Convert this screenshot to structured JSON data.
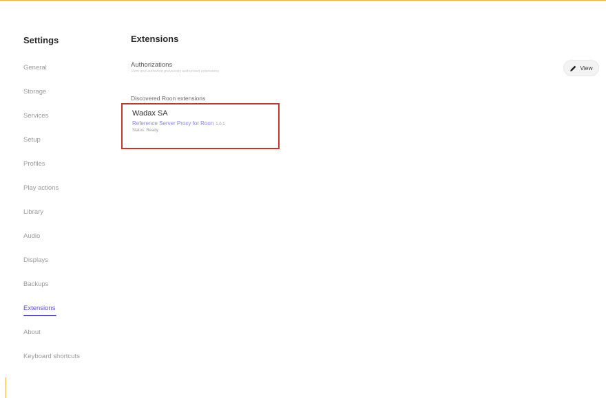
{
  "sidebar": {
    "title": "Settings",
    "items": [
      {
        "label": "General",
        "active": false
      },
      {
        "label": "Storage",
        "active": false
      },
      {
        "label": "Services",
        "active": false
      },
      {
        "label": "Setup",
        "active": false
      },
      {
        "label": "Profiles",
        "active": false
      },
      {
        "label": "Play actions",
        "active": false
      },
      {
        "label": "Library",
        "active": false
      },
      {
        "label": "Audio",
        "active": false
      },
      {
        "label": "Displays",
        "active": false
      },
      {
        "label": "Backups",
        "active": false
      },
      {
        "label": "Extensions",
        "active": true
      },
      {
        "label": "About",
        "active": false
      },
      {
        "label": "Keyboard shortcuts",
        "active": false
      }
    ]
  },
  "main": {
    "title": "Extensions",
    "authorizations": {
      "title": "Authorizations",
      "description": "View and authorize previously authorized extensions",
      "view_button_label": "View",
      "view_icon": "pencil-icon"
    },
    "discovered_label": "Discovered Roon extensions",
    "extension": {
      "name": "Wadax SA",
      "description": "Reference Server Proxy for Roon",
      "version": "1.0.1",
      "status": "Status: Ready"
    }
  },
  "colors": {
    "accent": "#5b4fd0",
    "highlight_border": "#c0392b",
    "window_border": "#e8b04a"
  }
}
